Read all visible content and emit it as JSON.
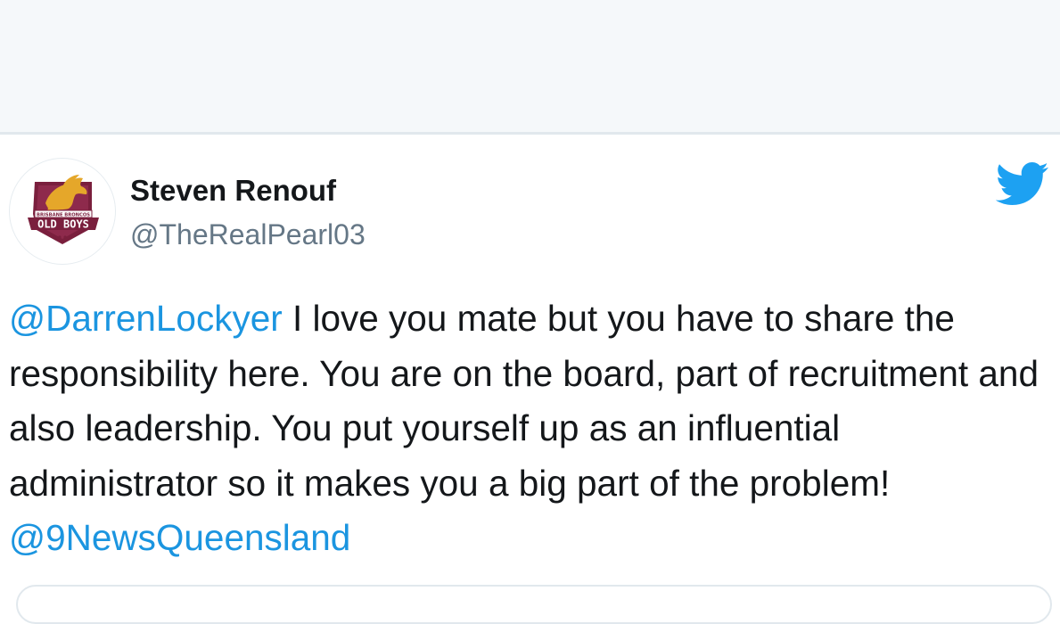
{
  "tweet": {
    "author": {
      "display_name": "Steven Renouf",
      "handle": "@TheRealPearl03",
      "avatar": {
        "icon": "brisbane-broncos-old-boys-logo",
        "logo_text_top": "BRISBANE BRONCOS",
        "logo_text_main": "OLD BOYS",
        "colors": {
          "maroon": "#7a1f3d",
          "gold": "#e5a72a"
        }
      }
    },
    "brand_icon": "twitter-bird-icon",
    "text": {
      "mention_start": "@DarrenLockyer",
      "body": " I love you mate but you have to share the responsibility here. You are on the board, part of recruitment and also leadership. You put yourself up as an influential administrator so it makes you a big part of the problem! ",
      "mention_end": "@9NewsQueensland"
    }
  },
  "colors": {
    "link": "#1b95e0",
    "text": "#14171a",
    "secondary": "#657786",
    "twitter_blue": "#1da1f2",
    "background_top": "#f5f8fa"
  }
}
